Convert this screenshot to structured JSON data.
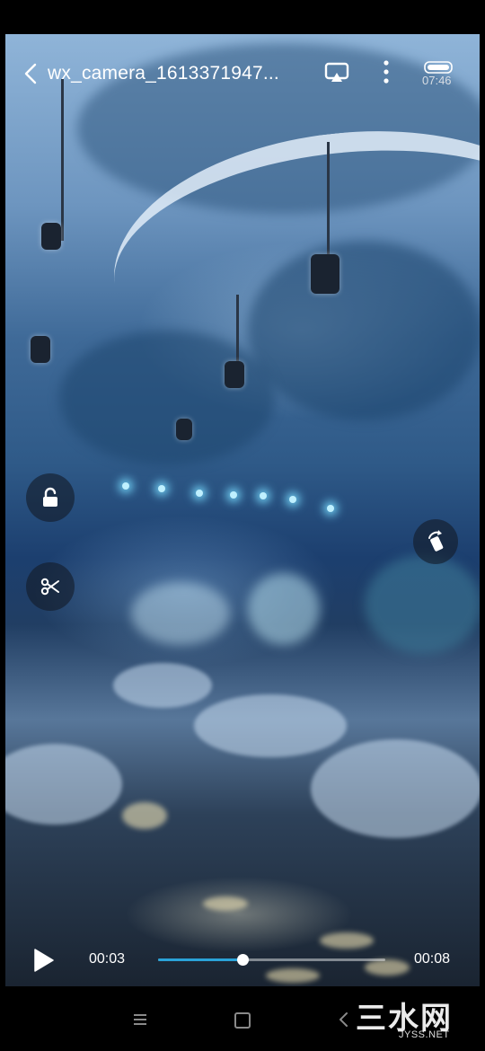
{
  "header": {
    "back_icon": "chevron-left-icon",
    "title": "wx_camera_1613371947...",
    "cast_icon": "screen-cast-icon",
    "more_icon": "more-vertical-icon",
    "battery_icon": "battery-icon",
    "clock": "07:46"
  },
  "side_controls": {
    "lock_icon": "unlock-icon",
    "cut_icon": "scissors-icon",
    "rotate_icon": "rotate-screen-icon"
  },
  "player": {
    "play_icon": "play-icon",
    "current_time": "00:03",
    "total_time": "00:08",
    "progress": 0.37,
    "accent_color": "#2aa3d8"
  },
  "nav": {
    "menu_icon": "menu-icon",
    "home_icon": "home-square-icon",
    "back_icon": "back-chevron-icon"
  },
  "watermark": {
    "name": "三水网",
    "site": "JYSS.NET"
  }
}
